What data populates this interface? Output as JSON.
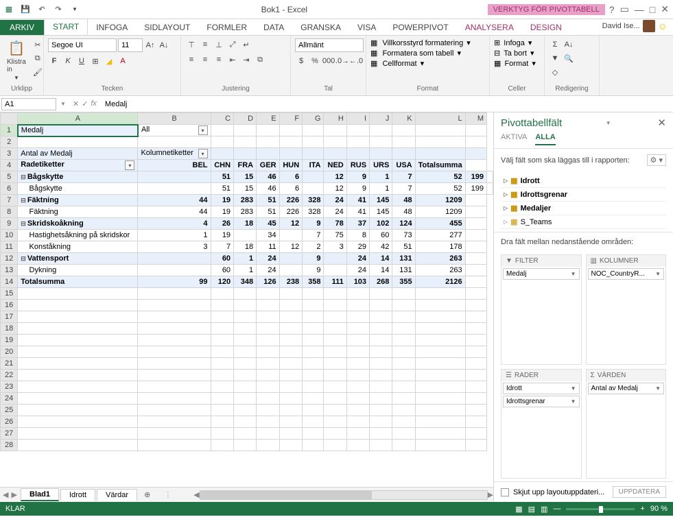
{
  "titlebar": {
    "title": "Bok1 - Excel",
    "pivot_tools": "VERKTYG FÖR PIVOTTABELL"
  },
  "tabs": {
    "file": "ARKIV",
    "home": "START",
    "insert": "INFOGA",
    "layout": "SIDLAYOUT",
    "formulas": "FORMLER",
    "data": "DATA",
    "review": "GRANSKA",
    "view": "VISA",
    "powerpivot": "POWERPIVOT",
    "analyze": "ANALYSERA",
    "design": "DESIGN",
    "user": "David Ise..."
  },
  "ribbon": {
    "clipboard": {
      "paste": "Klistra in",
      "group": "Urklipp"
    },
    "font": {
      "name": "Segoe UI",
      "size": "11",
      "group": "Tecken"
    },
    "align": {
      "group": "Justering"
    },
    "number": {
      "format": "Allmänt",
      "group": "Tal"
    },
    "styles": {
      "cond": "Villkorsstyrd formatering",
      "table": "Formatera som tabell",
      "cell": "Cellformat",
      "group": "Format"
    },
    "cells": {
      "insert": "Infoga",
      "delete": "Ta bort",
      "format": "Format",
      "group": "Celler"
    },
    "editing": {
      "group": "Redigering"
    }
  },
  "formula": {
    "name_box": "A1",
    "value": "Medalj"
  },
  "cols": [
    "A",
    "B",
    "C",
    "D",
    "E",
    "F",
    "G",
    "H",
    "I",
    "J",
    "K",
    "L",
    "M"
  ],
  "colhdr": [
    "",
    "BEL",
    "CHN",
    "FRA",
    "GER",
    "HUN",
    "ITA",
    "NED",
    "RUS",
    "URS",
    "USA",
    "Totalsumma"
  ],
  "pivot": {
    "filter_label": "Medalj",
    "filter_value": "All",
    "count_label": "Antal av Medalj",
    "col_label": "Kolumnetiketter",
    "row_label": "Radetiketter",
    "rows": [
      {
        "i": 5,
        "lvl": 0,
        "name": "Bågskytte",
        "exp": "−",
        "v": [
          "",
          "51",
          "15",
          "46",
          "6",
          "",
          "12",
          "9",
          "1",
          "7",
          "52",
          "199"
        ],
        "b": true
      },
      {
        "i": 6,
        "lvl": 1,
        "name": "Bågskytte",
        "v": [
          "",
          "51",
          "15",
          "46",
          "6",
          "",
          "12",
          "9",
          "1",
          "7",
          "52",
          "199"
        ]
      },
      {
        "i": 7,
        "lvl": 0,
        "name": "Fäktning",
        "exp": "−",
        "v": [
          "44",
          "19",
          "283",
          "51",
          "226",
          "328",
          "24",
          "41",
          "145",
          "48",
          "1209"
        ],
        "b": true
      },
      {
        "i": 8,
        "lvl": 1,
        "name": "Fäktning",
        "v": [
          "44",
          "19",
          "283",
          "51",
          "226",
          "328",
          "24",
          "41",
          "145",
          "48",
          "1209"
        ]
      },
      {
        "i": 9,
        "lvl": 0,
        "name": "Skridskoåkning",
        "exp": "−",
        "v": [
          "4",
          "26",
          "18",
          "45",
          "12",
          "9",
          "78",
          "37",
          "102",
          "124",
          "455"
        ],
        "b": true
      },
      {
        "i": 10,
        "lvl": 1,
        "name": "Hastighetsåkning på skridskor",
        "v": [
          "1",
          "19",
          "",
          "34",
          "",
          "7",
          "75",
          "8",
          "60",
          "73",
          "277"
        ]
      },
      {
        "i": 11,
        "lvl": 1,
        "name": "Konståkning",
        "v": [
          "3",
          "7",
          "18",
          "11",
          "12",
          "2",
          "3",
          "29",
          "42",
          "51",
          "178"
        ]
      },
      {
        "i": 12,
        "lvl": 0,
        "name": "Vattensport",
        "exp": "−",
        "v": [
          "",
          "60",
          "1",
          "24",
          "",
          "9",
          "",
          "24",
          "14",
          "131",
          "263"
        ],
        "b": true
      },
      {
        "i": 13,
        "lvl": 1,
        "name": "Dykning",
        "v": [
          "",
          "60",
          "1",
          "24",
          "",
          "9",
          "",
          "24",
          "14",
          "131",
          "263"
        ]
      }
    ],
    "total_label": "Totalsumma",
    "total": [
      "99",
      "120",
      "348",
      "126",
      "238",
      "358",
      "111",
      "103",
      "268",
      "355",
      "2126"
    ]
  },
  "sheets": {
    "active": "Blad1",
    "s2": "Idrott",
    "s3": "Värdar"
  },
  "pane": {
    "title": "Pivottabellfält",
    "tab_active": "AKTIVA",
    "tab_all": "ALLA",
    "hint": "Välj fält som ska läggas till i rapporten:",
    "fields": [
      "Idrott",
      "Idrottsgrenar",
      "Medaljer",
      "S_Teams"
    ],
    "areas_hint": "Dra fält mellan nedanstående områden:",
    "filter_hdr": "FILTER",
    "columns_hdr": "KOLUMNER",
    "rows_hdr": "RADER",
    "values_hdr": "VÄRDEN",
    "filter_chip": "Medalj",
    "columns_chip": "NOC_CountryR...",
    "rows_chip1": "Idrott",
    "rows_chip2": "Idrottsgrenar",
    "values_chip": "Antal av Medalj",
    "defer": "Skjut upp layoutuppdateri...",
    "update": "UPPDATERA"
  },
  "status": {
    "ready": "KLAR",
    "zoom": "90 %"
  }
}
